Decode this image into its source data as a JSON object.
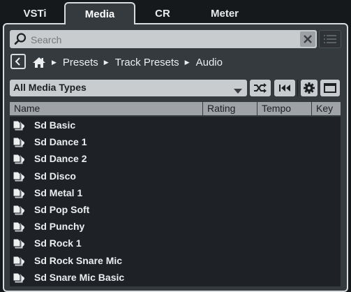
{
  "tabs": [
    {
      "label": "VSTi"
    },
    {
      "label": "Media",
      "active": true
    },
    {
      "label": "CR"
    },
    {
      "label": "Meter"
    }
  ],
  "search": {
    "placeholder": "Search",
    "value": ""
  },
  "breadcrumb": [
    "Presets",
    "Track Presets",
    "Audio"
  ],
  "filter": {
    "selected": "All Media Types"
  },
  "columns": [
    "Name",
    "Rating",
    "Tempo",
    "Key"
  ],
  "files": [
    "Sd Basic",
    "Sd Dance 1",
    "Sd Dance 2",
    "Sd Disco",
    "Sd Metal 1",
    "Sd Pop Soft",
    "Sd Punchy",
    "Sd Rock 1",
    "Sd Rock Snare Mic",
    "Sd Snare Mic Basic"
  ],
  "icons": {
    "search": "magnifier-icon",
    "clear": "clear-x-icon",
    "list": "list-view-icon",
    "back": "chevron-left-icon",
    "home": "home-icon",
    "dropdown": "caret-down-icon",
    "shuffle": "shuffle-icon",
    "rewind": "skip-back-icon",
    "settings": "gear-icon",
    "window": "window-icon",
    "preset": "track-preset-icon"
  },
  "colors": {
    "background": "#16191c",
    "panel": "#353a3f",
    "list_background": "#1e2226",
    "field": "#c9cccf",
    "header": "#9fa3a7",
    "text": "#eceef0"
  }
}
